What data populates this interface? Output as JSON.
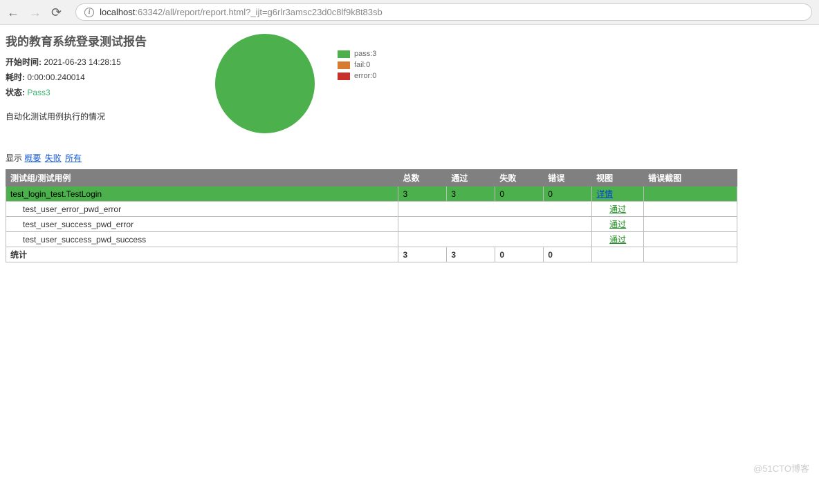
{
  "browser": {
    "url_host": "localhost",
    "url_path": ":63342/all/report/report.html?_ijt=g6rlr3amsc23d0c8lf9k8t83sb"
  },
  "report": {
    "title": "我的教育系统登录测试报告",
    "start_label": "开始时间:",
    "start_value": "2021-06-23 14:28:15",
    "duration_label": "耗时:",
    "duration_value": "0:00:00.240014",
    "status_label": "状态:",
    "status_value": "Pass",
    "status_count": "3",
    "description": "自动化测试用例执行的情况"
  },
  "legend": {
    "pass": "pass:3",
    "fail": "fail:0",
    "error": "error:0"
  },
  "filter": {
    "label": "显示",
    "summary": "概要",
    "fail": "失败",
    "all": "所有"
  },
  "table": {
    "headers": {
      "name": "测试组/测试用例",
      "total": "总数",
      "pass": "通过",
      "fail": "失败",
      "error": "错误",
      "view": "视图",
      "screenshot": "错误截图"
    },
    "suite": {
      "name": "test_login_test.TestLogin",
      "total": "3",
      "pass": "3",
      "fail": "0",
      "error": "0",
      "detail": "详情"
    },
    "cases": [
      {
        "name": "test_user_error_pwd_error",
        "result": "通过"
      },
      {
        "name": "test_user_success_pwd_error",
        "result": "通过"
      },
      {
        "name": "test_user_success_pwd_success",
        "result": "通过"
      }
    ],
    "total_row": {
      "label": "统计",
      "total": "3",
      "pass": "3",
      "fail": "0",
      "error": "0"
    }
  },
  "watermark": "@51CTO博客",
  "chart_data": {
    "type": "pie",
    "title": "",
    "series": [
      {
        "name": "pass",
        "value": 3,
        "color": "#4cb04c"
      },
      {
        "name": "fail",
        "value": 0,
        "color": "#d97b2e"
      },
      {
        "name": "error",
        "value": 0,
        "color": "#c9302c"
      }
    ]
  }
}
